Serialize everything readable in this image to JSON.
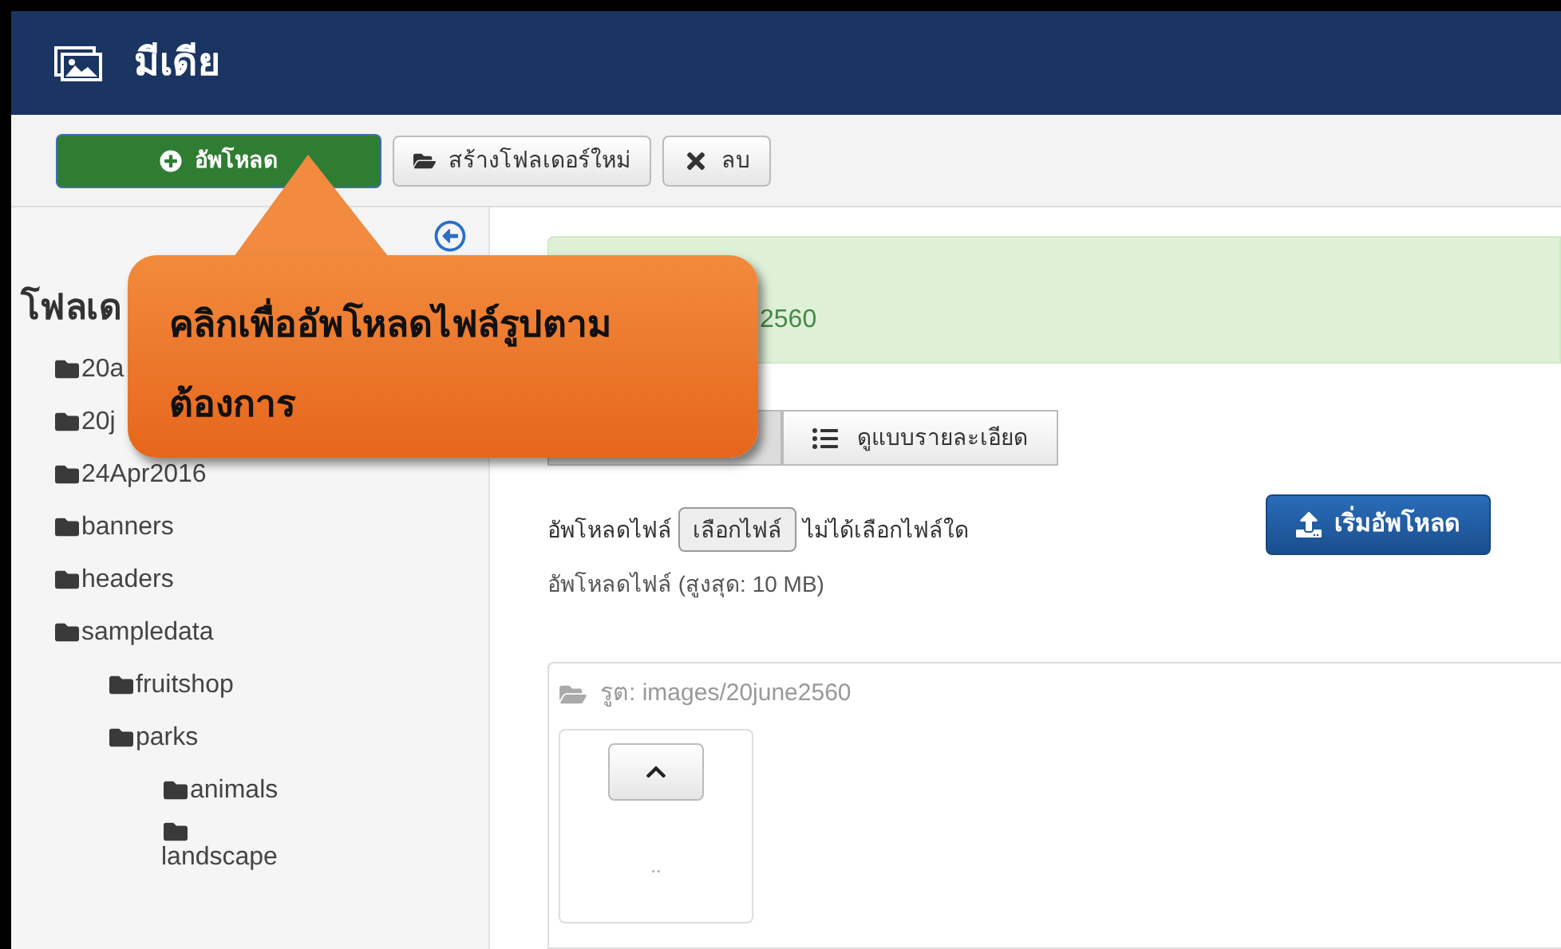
{
  "header": {
    "title": "มีเดีย"
  },
  "toolbar": [
    {
      "kind": "upload",
      "label": "อัพโหลด"
    },
    {
      "kind": "folder",
      "label": "สร้างโฟลเดอร์ใหม่"
    },
    {
      "kind": "delete",
      "label": "ลบ"
    }
  ],
  "sidebar": {
    "heading": "โฟลเด",
    "items": [
      {
        "label": "20a"
      },
      {
        "label": "20j"
      },
      {
        "label": "24Apr2016"
      },
      {
        "label": "banners"
      },
      {
        "label": "headers"
      },
      {
        "label": "sampledata",
        "children": [
          {
            "label": "fruitshop"
          },
          {
            "label": "parks",
            "children": [
              {
                "label": "animals"
              },
              {
                "label": "landscape",
                "kind": "wrapped"
              }
            ]
          }
        ]
      }
    ]
  },
  "alert": {
    "text": "2560"
  },
  "view_tabs": [
    {
      "selected": true
    },
    {
      "label": "ดูแบบรายละเอียด",
      "selected": false
    }
  ],
  "upload": {
    "label": "อัพโหลดไฟล์",
    "choose_button": "เลือกไฟล์",
    "no_file": "ไม่ได้เลือกไฟล์ใด",
    "start_button": "เริ่มอัพโหลด",
    "limit": "อัพโหลดไฟล์ (สูงสุด: 10 MB)"
  },
  "browser": {
    "path": "รูต: images/20june2560",
    "items": [
      {
        "kind": "up",
        "label": ".."
      }
    ]
  },
  "callout": {
    "text": "คลิกเพื่ออัพโหลดไฟล์รูปตาม ต้องการ"
  }
}
